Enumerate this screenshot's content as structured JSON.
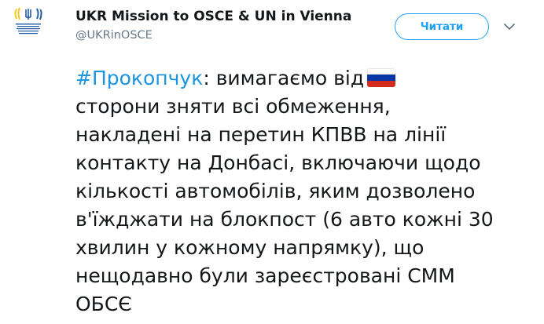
{
  "account": {
    "name": "UKR Mission to OSCE & UN in Vienna",
    "handle": "@UKRinOSCE",
    "avatar_icon": "mission-logo-icon"
  },
  "follow_button": {
    "label": "Читати"
  },
  "menu": {
    "icon": "chevron-down-icon"
  },
  "tweet": {
    "hashtag": "#Прокопчук",
    "line1_rest": ": вимагаємо від",
    "flag_icon": "russia-flag-icon",
    "lines": [
      "сторони зняти всі обмеження,",
      "накладені на перетин КПВВ на лінії",
      "контакту на Донбасі, включаючи щодо",
      "кількості автомобілів, яким дозволено",
      "в'їжджати на блокпост (6 авто кожні 30",
      "хвилин у кожному напрямку), що",
      "нещодавно були зареєстровані СММ",
      "ОБСЄ"
    ]
  },
  "colors": {
    "accent": "#1da1f2",
    "hashtag": "#1b95e0",
    "text": "#14171a",
    "muted": "#657786",
    "flag_white": "#ffffff",
    "flag_blue": "#0039a6",
    "flag_red": "#d52b1e",
    "logo_yellow": "#f5c518",
    "logo_blue": "#1f5aa6"
  }
}
